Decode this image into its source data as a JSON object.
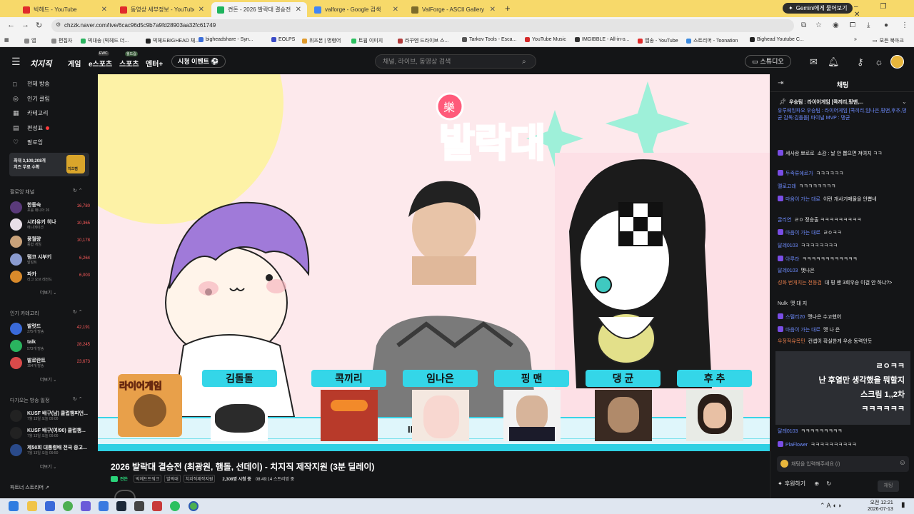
{
  "browser": {
    "tabs": [
      {
        "label": "빅헤드 - YouTube",
        "color": "#e02b2b"
      },
      {
        "label": "동영상 세부정보 - YouTube Studio",
        "color": "#e02b2b"
      },
      {
        "label": "켠돈 - 2026 발락대 결승전 (최",
        "color": "#1eb45d"
      },
      {
        "label": "valforge - Google 검색",
        "color": "#4285f4"
      },
      {
        "label": "ValForge - ASCII Gallery",
        "color": "#7c6b2b"
      }
    ],
    "new_tab": "+",
    "gemini_label": "Gemini에게 물어보기",
    "window_controls": "–  ❐  ✕",
    "url": "chzzk.naver.com/live/6cac96d5c9b7a9fd28903aa32fc61749",
    "bookmarks": [
      {
        "label": "앱",
        "color": "#888888"
      },
      {
        "label": "편집자",
        "color": "#888888"
      },
      {
        "label": "빅대송 (빅헤드 더...",
        "color": "#2ab45f"
      },
      {
        "label": "빅헤드BIGHEAD 채...",
        "color": "#222222"
      },
      {
        "label": "bigheadshare - Syn...",
        "color": "#3c6fd9"
      },
      {
        "label": "EOLPS",
        "color": "#3b4bc8"
      },
      {
        "label": "위즈본 | 명령어",
        "color": "#e09a2b"
      },
      {
        "label": "트윕 이미지",
        "color": "#2bc05f"
      },
      {
        "label": "라꾸엔 드라이브 스...",
        "color": "#b23b3b"
      },
      {
        "label": "Tarkov Tools - Esca...",
        "color": "#555555"
      },
      {
        "label": "YouTube Music",
        "color": "#d42a2a"
      },
      {
        "label": "IMGIBBLE - All-in-o...",
        "color": "#333333"
      },
      {
        "label": "앱송 - YouTube",
        "color": "#e02b2b"
      },
      {
        "label": "스트리머 - Toonation",
        "color": "#3c8be0"
      },
      {
        "label": "Bighead Youtube C...",
        "color": "#222222"
      }
    ],
    "bookmarks_more": "»",
    "all_bookmarks": "모든 북마크"
  },
  "site": {
    "logo": "치지직",
    "nav": [
      "게임",
      "e스포츠",
      "스포츠",
      "엔터+"
    ],
    "nav_badges": [
      "EWC",
      "월드컵"
    ],
    "event_button": "시청 이벤트 ⚽",
    "search_placeholder": "채널, 라이브, 동영상 검색",
    "studio_button": "스튜디오"
  },
  "sidebar": {
    "menu": [
      {
        "label": "전체 방송",
        "icon": "□"
      },
      {
        "label": "인기 클립",
        "icon": "◎"
      },
      {
        "label": "카테고리",
        "icon": "▦"
      },
      {
        "label": "편성표",
        "icon": "▤"
      },
      {
        "label": "팔로잉",
        "icon": "♡"
      }
    ],
    "cheese_banner": "최대 3,109,208개\n치즈 무료 수확",
    "cheese_badge": "치즈캠",
    "following_title": "팔로잉 채널",
    "following": [
      {
        "name": "한동숙",
        "sub": "포롤 매니아 26",
        "viewers": "16,780",
        "color": "#5a3a7a"
      },
      {
        "name": "시라유키 히나",
        "sub": "에니메이션",
        "viewers": "10,365",
        "color": "#e8dfe8"
      },
      {
        "name": "풍월량",
        "sub": "종합 게임",
        "viewers": "10,178",
        "color": "#c9a27a"
      },
      {
        "name": "탬코 시부키",
        "sub": "발럿트",
        "viewers": "6,264",
        "color": "#8a9bd0"
      },
      {
        "name": "파카",
        "sub": "리그 오브 레전드",
        "viewers": "6,003",
        "color": "#d98a2b"
      }
    ],
    "popular_cat_title": "인기 카테고리",
    "categories": [
      {
        "name": "발럿드",
        "sub": "375개 방송",
        "viewers": "42,191",
        "color": "#3a6ad9"
      },
      {
        "name": "talk",
        "sub": "573개 방송",
        "viewers": "28,245",
        "color": "#2ab45f"
      },
      {
        "name": "발로란트",
        "sub": "154개 방송",
        "viewers": "23,673",
        "color": "#d94a4a"
      }
    ],
    "upcoming_title": "다가오는 방송 일정",
    "upcoming": [
      {
        "name": "KUSF 배구(남) 클럽챔피언...",
        "sub": "7월 13일 오늘 09:00",
        "color": "#222"
      },
      {
        "name": "KUSF 배구(여/90) 클럽챔...",
        "sub": "7월 13일 오늘 09:00",
        "color": "#222"
      },
      {
        "name": "제50회 대통령배 전국 중고...",
        "sub": "7월 13일 오늘 09:50",
        "color": "#2a4a8a"
      }
    ],
    "more_label": "더보기 ⌄",
    "partner_label": "파트너 스트리머 ↗"
  },
  "player": {
    "logo_text": "발락대",
    "logo_badge": "樂",
    "interview_label": "INTERVIEW",
    "team_logo_text": "라이어게임",
    "players": [
      "김돌돌",
      "콕끼리",
      "임나은",
      "핑 맨",
      "댕 균",
      "후 추"
    ]
  },
  "video": {
    "title": "2026 발락대 결승전 (최광원, 햄돌, 선데이) - 치지직 제작지원 (3분 딜레이)",
    "channel": "켠돈",
    "tags": [
      "빅헤드트워크",
      "발락대",
      "치지직제작지원"
    ],
    "viewers_text": "2,308명 시청 중",
    "duration_text": "08:49:14 스트리밍 중"
  },
  "chat": {
    "title": "채팅",
    "pinned_title": "우승팀 : 라이어게임 [콕끼리,핑맨,...",
    "pinned_body": "유루에잉파오 우승팀 : 라이어게임 [콕끼리,임나은,핑맨,후추,댕균 감독:김돌돌] 파이널 MVP : 댕균",
    "messages": [
      {
        "user": "세사람 뽀로로",
        "text": "소감 : 날 안 뽑으면 져여지 ㅋㅋ",
        "cls": "w",
        "badge": true
      },
      {
        "user": "두족류에르가",
        "text": "ㅋㅋㅋㅋㅋㅋ",
        "cls": "",
        "badge": true
      },
      {
        "user": "멜로고래",
        "text": "ㅋㅋㅋㅋㅋㅋㅋㅋ",
        "cls": "",
        "badge": false
      },
      {
        "user": "마음이 가는 대로",
        "text": "이런 개사기매물을 안뽑네",
        "cls": "",
        "badge": true
      },
      {
        "user": "굴리연",
        "text": "ㄹㅇ 정승출 ㅋㅋㅋㅋㅋㅋㅋㅋㅋ",
        "cls": "",
        "badge": false
      },
      {
        "user": "마음이 가는 대로",
        "text": "ㄹㅇㅋㅋ",
        "cls": "",
        "badge": true
      },
      {
        "user": "달레0103",
        "text": "ㅋㅋㅋㅋㅋㅋㅋㅋ",
        "cls": "",
        "badge": false
      },
      {
        "user": "아루라",
        "text": "ㅋㅋㅋㅋㅋㅋㅋㅋㅋㅋㅋㅋ",
        "cls": "",
        "badge": true
      },
      {
        "user": "달레0103",
        "text": "멧나은",
        "cls": "",
        "badge": false
      },
      {
        "user": "성화 번개치는 천둥검",
        "text": "대 핑 맨 3회우승 이걸 안 하냐?>",
        "cls": "o",
        "badge": false
      },
      {
        "user": "Nulk",
        "text": "멧 대 지",
        "cls": "w",
        "badge": false
      },
      {
        "user": "스텔리20",
        "text": "멧나은 수고했어",
        "cls": "",
        "badge": true
      },
      {
        "user": "마음이 가는 대로",
        "text": "멧 나 은",
        "cls": "",
        "badge": true
      },
      {
        "user": "우정적유목민",
        "text": "컨셉이 확실한게 우승 동력인듯",
        "cls": "o",
        "badge": false
      }
    ],
    "donation_lines": [
      "ㄹㅇㅋㅋ",
      "난 후열만 생각했을 뭐할지",
      "스크림 1,,2차",
      "ㅋㅋㅋㅋㅋㅋ"
    ],
    "after_messages": [
      {
        "user": "달레0103",
        "text": "ㅋㅋㅋㅋㅋㅋㅋㅋㅋ",
        "cls": "",
        "badge": false
      },
      {
        "user": "PlaFlower",
        "text": "ㅋㅋㅋㅋㅋㅋㅋㅋㅋㅋ",
        "cls": "",
        "badge": true
      }
    ],
    "input_placeholder": "채팅을 입력해주세요 (/)",
    "donate_label": "후원하기",
    "send_label": "채팅"
  },
  "taskbar": {
    "time": "오전 12:21",
    "date": "2026-07-13"
  }
}
